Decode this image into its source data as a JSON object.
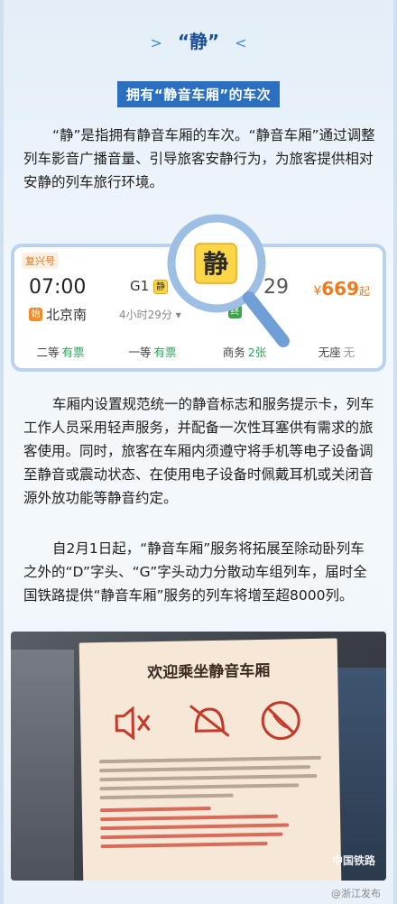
{
  "header": {
    "chev_left": ">",
    "title": "“静”",
    "chev_right": "<"
  },
  "subhead": "拥有“静音车厢”的车次",
  "paragraphs": {
    "p1": "“静”是指拥有静音车厢的车次。“静音车厢”通过调整列车影音广播音量、引导旅客安静行为，为旅客提供相对安静的列车旅行环境。",
    "p2": "车厢内设置规范统一的静音标志和服务提示卡，列车工作人员采用轻声服务，并配备一次性耳塞供有需求的旅客使用。同时，旅客在车厢内须遵守将手机等电子设备调至静音或震动状态、在使用电子设备时佩戴耳机或关闭音源外放功能等静音约定。",
    "p3": "自2月1日起，“静音车厢”服务将拓展至除动卧列车之外的“D”字头、“G”字头动力分散动车组列车，届时全国铁路提供“静音车厢”服务的列车将增至超8000列。"
  },
  "ticket": {
    "badge": "复兴号",
    "dep_time": "07:00",
    "dep_tag": "始",
    "dep_station": "北京南",
    "train_prefix": "G1",
    "quiet_tag": "静",
    "duration": "4小时29分",
    "arr_suffix": "29",
    "arr_tag": "终",
    "price_currency": "¥",
    "price": "669",
    "price_suffix": "起",
    "seats": [
      {
        "class": "二等",
        "status": "有票"
      },
      {
        "class": "一等",
        "status": "有票"
      },
      {
        "class": "商务",
        "status": "2张"
      },
      {
        "class": "无座",
        "status": "无"
      }
    ]
  },
  "magnifier_text": "静",
  "photo": {
    "sign_title": "欢迎乘坐静音车厢",
    "logo": "中国铁路"
  },
  "watermark": "@浙江发布",
  "colors": {
    "accent": "#2a6fc0",
    "price": "#f07a20",
    "available": "#2aa35a",
    "quiet": "#fcd646"
  }
}
